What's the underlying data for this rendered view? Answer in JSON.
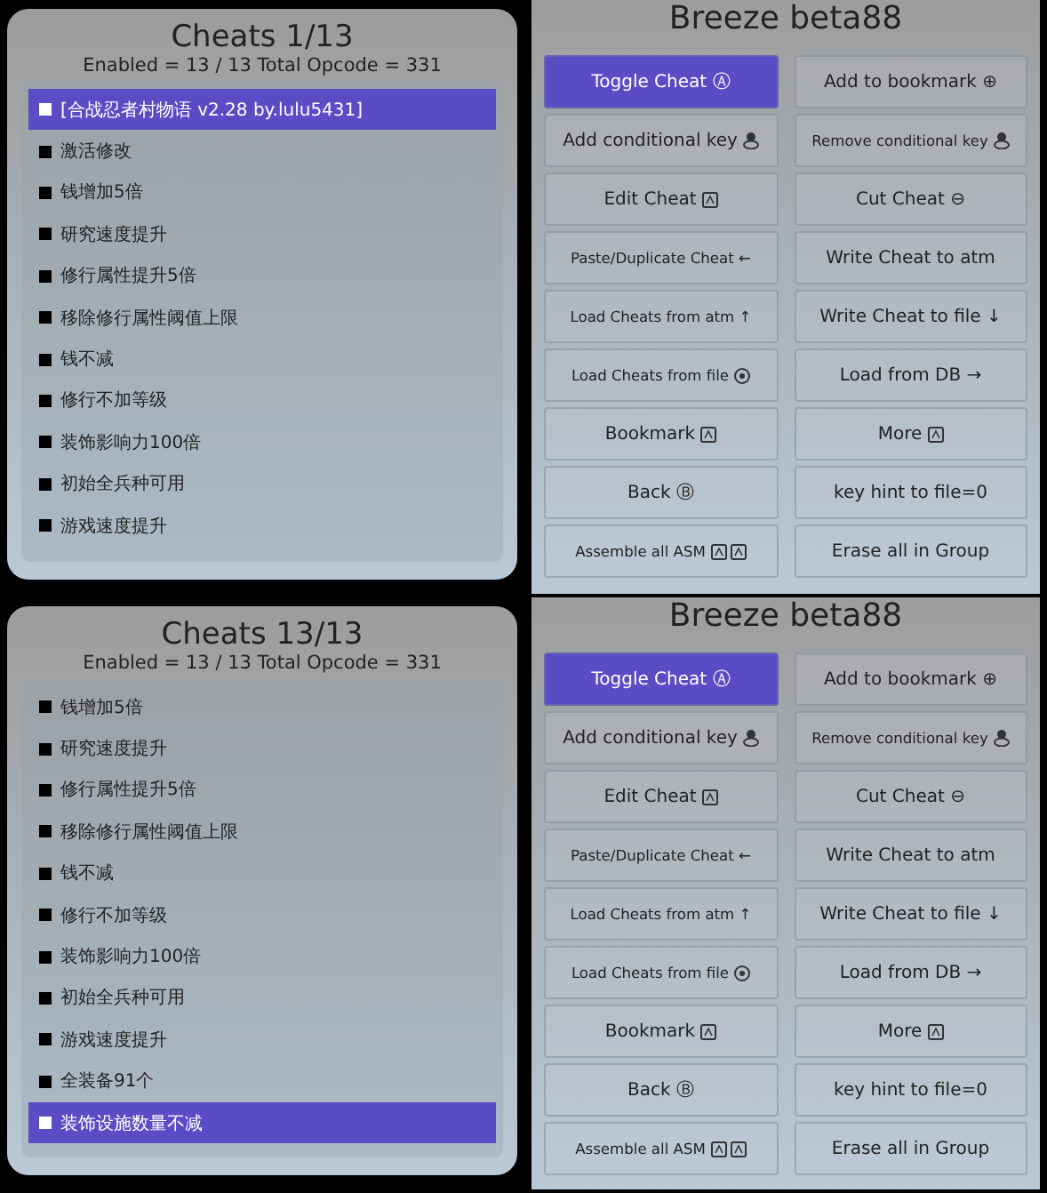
{
  "screens": [
    {
      "cheats": {
        "title": "Cheats 1/13",
        "summary": "Enabled = 13 / 13  Total Opcode = 331",
        "items": [
          {
            "label": "[合战忍者村物语 v2.28 by.lulu5431]",
            "selected": true
          },
          {
            "label": "激活修改",
            "selected": false
          },
          {
            "label": "钱增加5倍",
            "selected": false
          },
          {
            "label": "研究速度提升",
            "selected": false
          },
          {
            "label": "修行属性提升5倍",
            "selected": false
          },
          {
            "label": "移除修行属性阈值上限",
            "selected": false
          },
          {
            "label": "钱不减",
            "selected": false
          },
          {
            "label": "修行不加等级",
            "selected": false
          },
          {
            "label": "装饰影响力100倍",
            "selected": false
          },
          {
            "label": "初始全兵种可用",
            "selected": false
          },
          {
            "label": "游戏速度提升",
            "selected": false
          }
        ]
      },
      "menu": {
        "title": "Breeze beta88",
        "buttons": [
          {
            "label": "Toggle Cheat",
            "glyph": "Ⓐ",
            "selected": true
          },
          {
            "label": "Add to bookmark",
            "glyph": "⊕",
            "selected": false
          },
          {
            "label": "Add conditional key",
            "icons": [
              {
                "kind": "stick"
              }
            ],
            "selected": false
          },
          {
            "label": "Remove conditional key",
            "icons": [
              {
                "kind": "stick"
              }
            ],
            "small": true,
            "selected": false
          },
          {
            "label": "Edit Cheat",
            "icons": [
              {
                "kind": "key"
              }
            ],
            "selected": false
          },
          {
            "label": "Cut Cheat",
            "glyph": "⊖",
            "selected": false
          },
          {
            "label": "Paste/Duplicate Cheat",
            "glyph": "←",
            "small": true,
            "selected": false
          },
          {
            "label": "Write Cheat to atm",
            "selected": false
          },
          {
            "label": "Load Cheats from atm",
            "glyph": "↑",
            "small": true,
            "selected": false
          },
          {
            "label": "Write Cheat to file",
            "glyph": "↓",
            "selected": false
          },
          {
            "label": "Load Cheats from file",
            "icons": [
              {
                "kind": "circle"
              }
            ],
            "small": true,
            "selected": false
          },
          {
            "label": "Load from DB",
            "glyph": "→",
            "selected": false
          },
          {
            "label": "Bookmark",
            "icons": [
              {
                "kind": "key"
              }
            ],
            "selected": false
          },
          {
            "label": "More",
            "icons": [
              {
                "kind": "key"
              }
            ],
            "selected": false
          },
          {
            "label": "Back",
            "glyph": "Ⓑ",
            "selected": false
          },
          {
            "label": "key hint to file=0",
            "selected": false
          },
          {
            "label": "Assemble all ASM",
            "icons": [
              {
                "kind": "key"
              },
              {
                "kind": "key"
              }
            ],
            "small": true,
            "selected": false
          },
          {
            "label": "Erase all in Group",
            "selected": false
          }
        ]
      }
    },
    {
      "cheats": {
        "title": "Cheats 13/13",
        "summary": "Enabled = 13 / 13  Total Opcode = 331",
        "items": [
          {
            "label": "钱增加5倍",
            "selected": false
          },
          {
            "label": "研究速度提升",
            "selected": false
          },
          {
            "label": "修行属性提升5倍",
            "selected": false
          },
          {
            "label": "移除修行属性阈值上限",
            "selected": false
          },
          {
            "label": "钱不减",
            "selected": false
          },
          {
            "label": "修行不加等级",
            "selected": false
          },
          {
            "label": "装饰影响力100倍",
            "selected": false
          },
          {
            "label": "初始全兵种可用",
            "selected": false
          },
          {
            "label": "游戏速度提升",
            "selected": false
          },
          {
            "label": "全装备91个",
            "selected": false
          },
          {
            "label": "装饰设施数量不减",
            "selected": true
          }
        ]
      },
      "menu": {
        "title": "Breeze beta88",
        "buttons": [
          {
            "label": "Toggle Cheat",
            "glyph": "Ⓐ",
            "selected": true
          },
          {
            "label": "Add to bookmark",
            "glyph": "⊕",
            "selected": false
          },
          {
            "label": "Add conditional key",
            "icons": [
              {
                "kind": "stick"
              }
            ],
            "selected": false
          },
          {
            "label": "Remove conditional key",
            "icons": [
              {
                "kind": "stick"
              }
            ],
            "small": true,
            "selected": false
          },
          {
            "label": "Edit Cheat",
            "icons": [
              {
                "kind": "key"
              }
            ],
            "selected": false
          },
          {
            "label": "Cut Cheat",
            "glyph": "⊖",
            "selected": false
          },
          {
            "label": "Paste/Duplicate Cheat",
            "glyph": "←",
            "small": true,
            "selected": false
          },
          {
            "label": "Write Cheat to atm",
            "selected": false
          },
          {
            "label": "Load Cheats from atm",
            "glyph": "↑",
            "small": true,
            "selected": false
          },
          {
            "label": "Write Cheat to file",
            "glyph": "↓",
            "selected": false
          },
          {
            "label": "Load Cheats from file",
            "icons": [
              {
                "kind": "circle"
              }
            ],
            "small": true,
            "selected": false
          },
          {
            "label": "Load from DB",
            "glyph": "→",
            "selected": false
          },
          {
            "label": "Bookmark",
            "icons": [
              {
                "kind": "key"
              }
            ],
            "selected": false
          },
          {
            "label": "More",
            "icons": [
              {
                "kind": "key"
              }
            ],
            "selected": false
          },
          {
            "label": "Back",
            "glyph": "Ⓑ",
            "selected": false
          },
          {
            "label": "key hint to file=0",
            "selected": false
          },
          {
            "label": "Assemble all ASM",
            "icons": [
              {
                "kind": "key"
              },
              {
                "kind": "key"
              }
            ],
            "small": true,
            "selected": false
          },
          {
            "label": "Erase all in Group",
            "selected": false
          }
        ]
      }
    }
  ]
}
